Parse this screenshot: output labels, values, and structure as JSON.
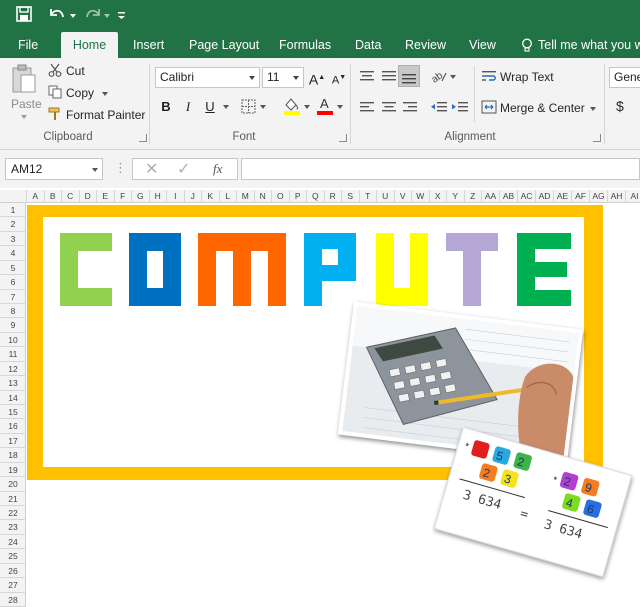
{
  "qat": {
    "save": "save-icon",
    "undo": "undo-icon",
    "redo": "redo-icon",
    "customize": "customize-icon"
  },
  "tabs": [
    "File",
    "Home",
    "Insert",
    "Page Layout",
    "Formulas",
    "Data",
    "Review",
    "View"
  ],
  "tell_me": "Tell me what you wa",
  "clipboard": {
    "paste": "Paste",
    "cut": "Cut",
    "copy": "Copy",
    "format_painter": "Format Painter",
    "label": "Clipboard"
  },
  "font": {
    "family": "Calibri",
    "size": "11",
    "grow": "A",
    "shrink": "A",
    "bold": "B",
    "italic": "I",
    "underline": "U",
    "fill_color": "#ffff00",
    "font_color": "#ff0000",
    "label": "Font"
  },
  "alignment": {
    "wrap_text": "Wrap Text",
    "merge_center": "Merge & Center",
    "label": "Alignment"
  },
  "number": {
    "format": "Gene",
    "currency": "$"
  },
  "formula_bar": {
    "name_box": "AM12",
    "fx": "fx",
    "value": ""
  },
  "columns": [
    "A",
    "B",
    "C",
    "D",
    "E",
    "F",
    "G",
    "H",
    "I",
    "J",
    "K",
    "L",
    "M",
    "N",
    "O",
    "P",
    "Q",
    "R",
    "S",
    "T",
    "U",
    "V",
    "W",
    "X",
    "Y",
    "Z",
    "AA",
    "AB",
    "AC",
    "AD",
    "AE",
    "AF",
    "AG",
    "AH",
    "AI"
  ],
  "rows": [
    "1",
    "2",
    "3",
    "4",
    "5",
    "6",
    "7",
    "8",
    "9",
    "10",
    "11",
    "12",
    "13",
    "14",
    "15",
    "16",
    "17",
    "18",
    "19",
    "20",
    "21",
    "22",
    "23",
    "24",
    "25",
    "26",
    "27",
    "28"
  ],
  "banner": {
    "letters": [
      "C",
      "O",
      "M",
      "P",
      "U",
      "T",
      "E"
    ],
    "colors": [
      "#92d050",
      "#0070c0",
      "#ff6600",
      "#00b0f0",
      "#ffff00",
      "#b4a7d6",
      "#00b050"
    ],
    "frame_color": "#ffc000"
  },
  "photo_note": {
    "expr1": "3 634",
    "expr2": "3 634",
    "eq": "="
  }
}
